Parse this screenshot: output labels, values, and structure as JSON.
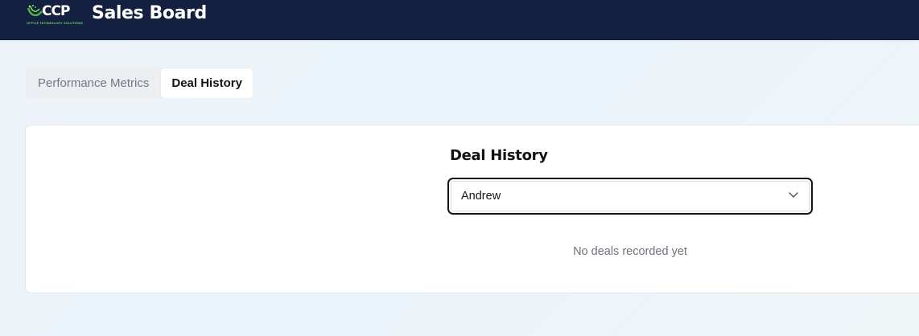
{
  "header": {
    "logo_text": "CCP",
    "logo_subtext": "OFFICE TECHNOLOGY SOLUTIONS",
    "title": "Sales Board",
    "background_color": "#13203f"
  },
  "tabs": [
    {
      "label": "Performance Metrics",
      "active": false
    },
    {
      "label": "Deal History",
      "active": true
    }
  ],
  "deal_history": {
    "title": "Deal History",
    "selected_person": "Andrew",
    "empty_message": "No deals recorded yet"
  },
  "icons": {
    "dropdown": "chevron-down-icon"
  }
}
